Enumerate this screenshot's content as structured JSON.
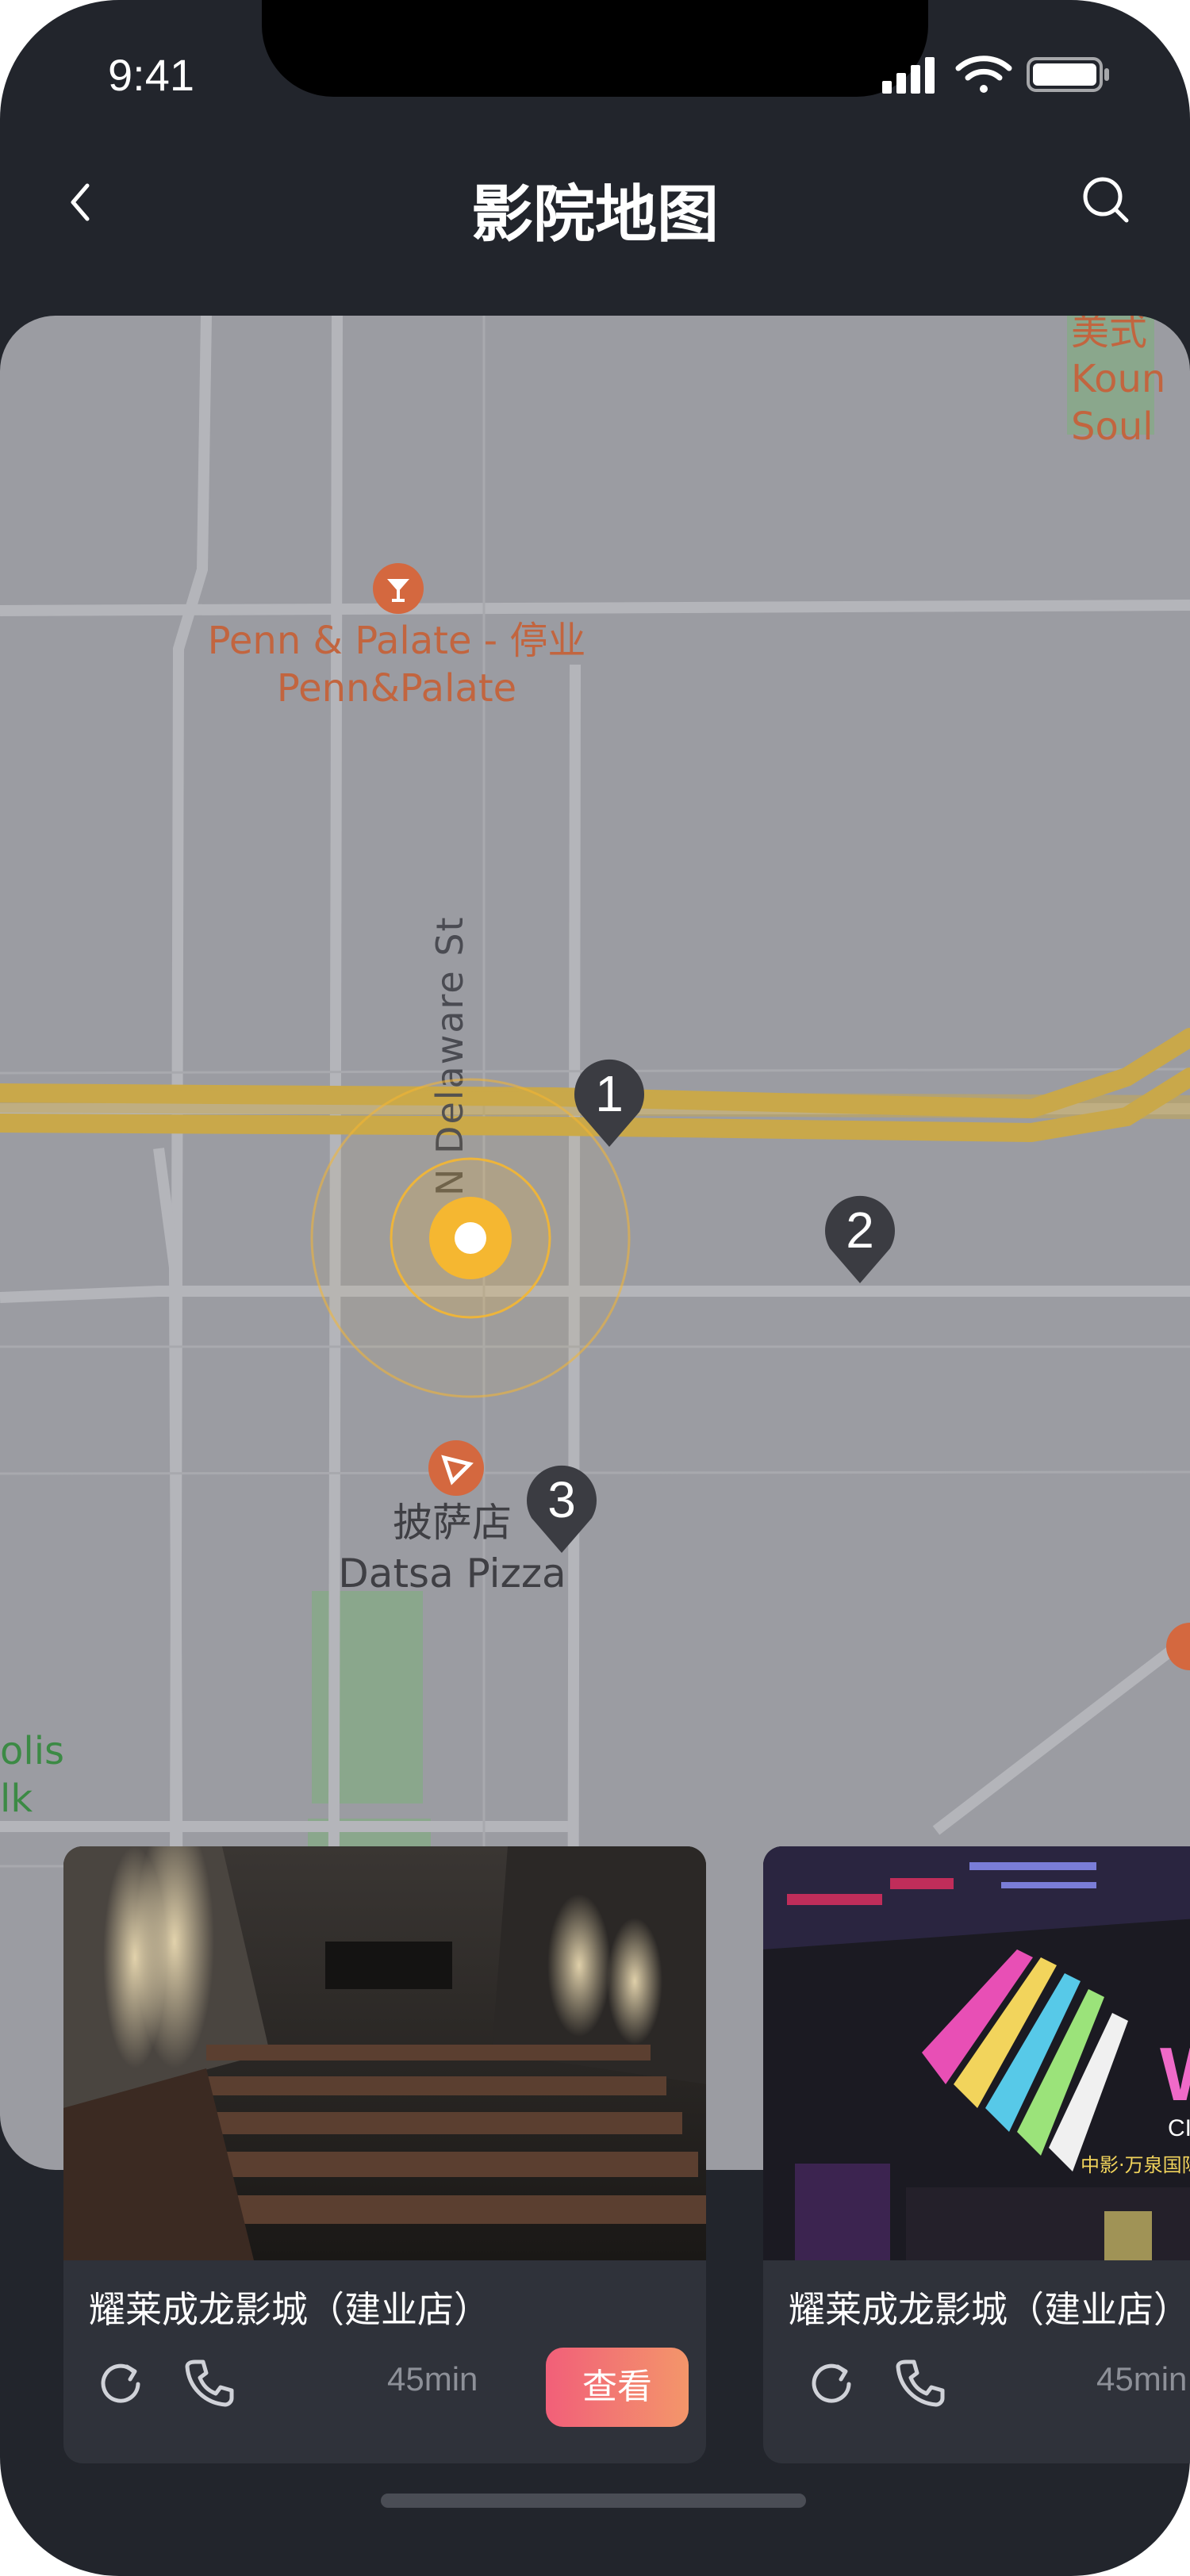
{
  "status_bar": {
    "time": "9:41"
  },
  "header": {
    "title": "影院地图",
    "back_icon": "chevron-left-icon",
    "search_icon": "search-icon"
  },
  "map": {
    "poi_bar": {
      "line1": "Penn & Palate - 停业",
      "line2": "Penn&Palate"
    },
    "poi_pizza": {
      "line1": "披萨店",
      "line2": "Datsa Pizza"
    },
    "top_right": {
      "line1": "美式",
      "line2": "Koun",
      "line3": "Soul"
    },
    "left_edge": {
      "line1": "olis",
      "line2": "lk"
    },
    "street_name": "N Delaware St",
    "markers": [
      "1",
      "2",
      "3"
    ],
    "colors": {
      "highway": "#c9a84a",
      "location": "#f5b731",
      "pin": "#3b3c42",
      "park": "#8aa78c"
    }
  },
  "cinemas": [
    {
      "name": "耀莱成龙影城（建业店）",
      "distance": "45min",
      "action": "查看"
    },
    {
      "name": "耀莱成龙影城（建业店）",
      "distance": "45min",
      "sign_text": "WO",
      "sign_sub": "CINEMA",
      "sign_cn": "中影·万泉国际"
    }
  ]
}
